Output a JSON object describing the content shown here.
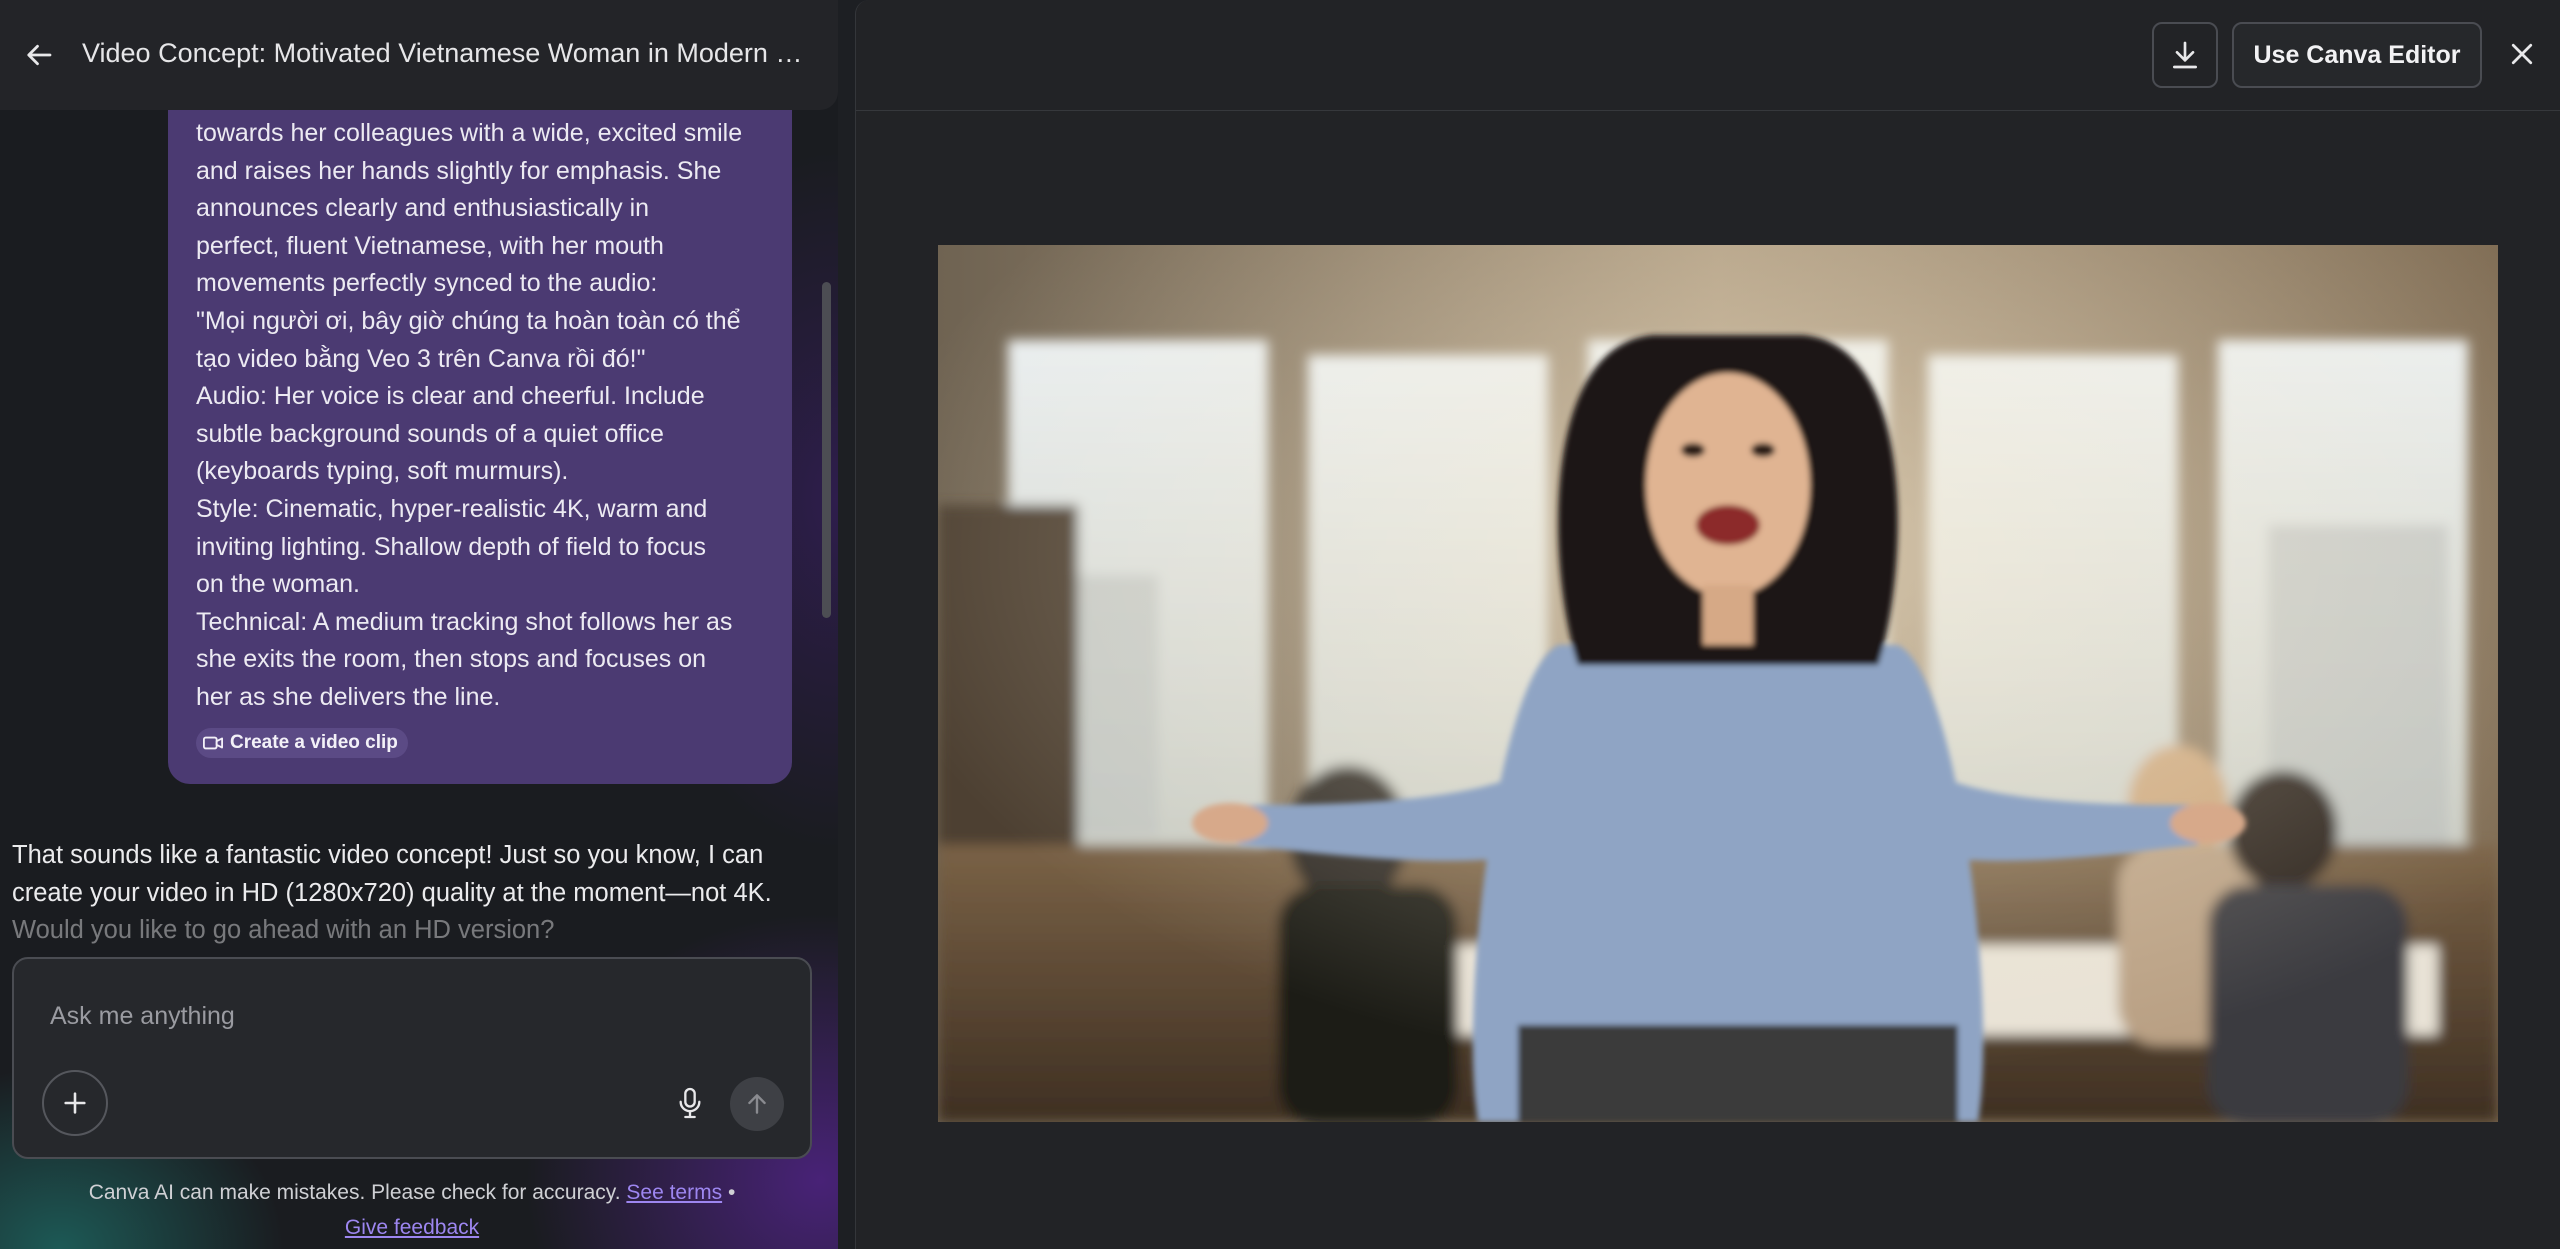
{
  "chat": {
    "title": "Video Concept: Motivated Vietnamese Woman in Modern Offi...",
    "prompt_text": "towards her colleagues with a wide, excited smile\nand raises her hands slightly for emphasis. She\nannounces clearly and enthusiastically in\nperfect, fluent Vietnamese, with her mouth\nmovements perfectly synced to the audio:\n\"Mọi người ơi, bây giờ chúng ta hoàn toàn có thể\ntạo video bằng Veo 3 trên Canva rồi đó!\"\nAudio: Her voice is clear and cheerful. Include\nsubtle background sounds of a quiet office\n(keyboards typing, soft murmurs).\nStyle: Cinematic, hyper-realistic 4K, warm and\ninviting lighting. Shallow depth of field to focus\non the woman.\nTechnical: A medium tracking shot follows her as\nshe exits the room, then stops and focuses on\nher as she delivers the line.",
    "chip_label": "Create a video clip",
    "reply_line1": "That sounds like a fantastic video concept! Just so you know, I can",
    "reply_line2": "create your video in HD (1280x720) quality at the moment—not 4K.",
    "reply_line3": "Would you like to go ahead with an HD version?",
    "input_placeholder": "Ask me anything",
    "disclaimer_text": "Canva AI can make mistakes. Please check for accuracy.",
    "see_terms": "See terms",
    "bullet": "•",
    "give_feedback": "Give feedback"
  },
  "preview": {
    "editor_button": "Use Canva Editor"
  },
  "icons": {
    "back": "arrow-left-icon",
    "chip": "video-camera-icon",
    "plus": "plus-icon",
    "mic": "microphone-icon",
    "send": "arrow-up-icon",
    "download": "download-icon",
    "close": "close-icon"
  },
  "colors": {
    "bubble": "#4b3a72",
    "link": "#9d86f0",
    "panel": "#222326"
  }
}
